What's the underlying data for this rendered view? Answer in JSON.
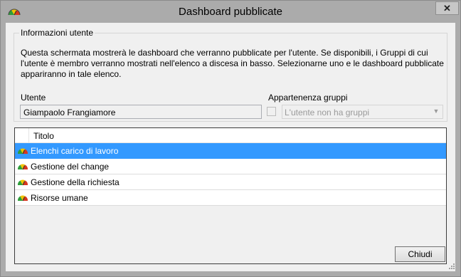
{
  "window": {
    "title": "Dashboard pubblicate",
    "close_symbol": "✕"
  },
  "user_info": {
    "group_title": "Informazioni utente",
    "description": "Questa schermata mostrerà le dashboard che verranno pubblicate per l'utente. Se disponibili, i Gruppi di cui l'utente è membro verranno mostrati nell'elenco a discesa in basso. Selezionarne uno e le dashboard pubblicate appariranno in tale elenco.",
    "user_label": "Utente",
    "user_value": "Giampaolo Frangiamore",
    "groups_label": "Appartenenza gruppi",
    "groups_value": "L'utente non ha gruppi",
    "groups_checked": false
  },
  "dashboards": {
    "column_title": "Titolo",
    "rows": [
      {
        "label": "Elenchi carico di lavoro",
        "icon": "gauge-icon",
        "selected": true
      },
      {
        "label": "Gestione del change",
        "icon": "gauge-icon",
        "selected": false
      },
      {
        "label": "Gestione della richiesta",
        "icon": "gauge-icon",
        "selected": false
      },
      {
        "label": "Risorse umane",
        "icon": "gauge-icon",
        "selected": false
      }
    ]
  },
  "footer": {
    "close_label": "Chiudi"
  },
  "colors": {
    "selection": "#3399ff",
    "frame": "#ababab",
    "client": "#f0f0f0"
  }
}
